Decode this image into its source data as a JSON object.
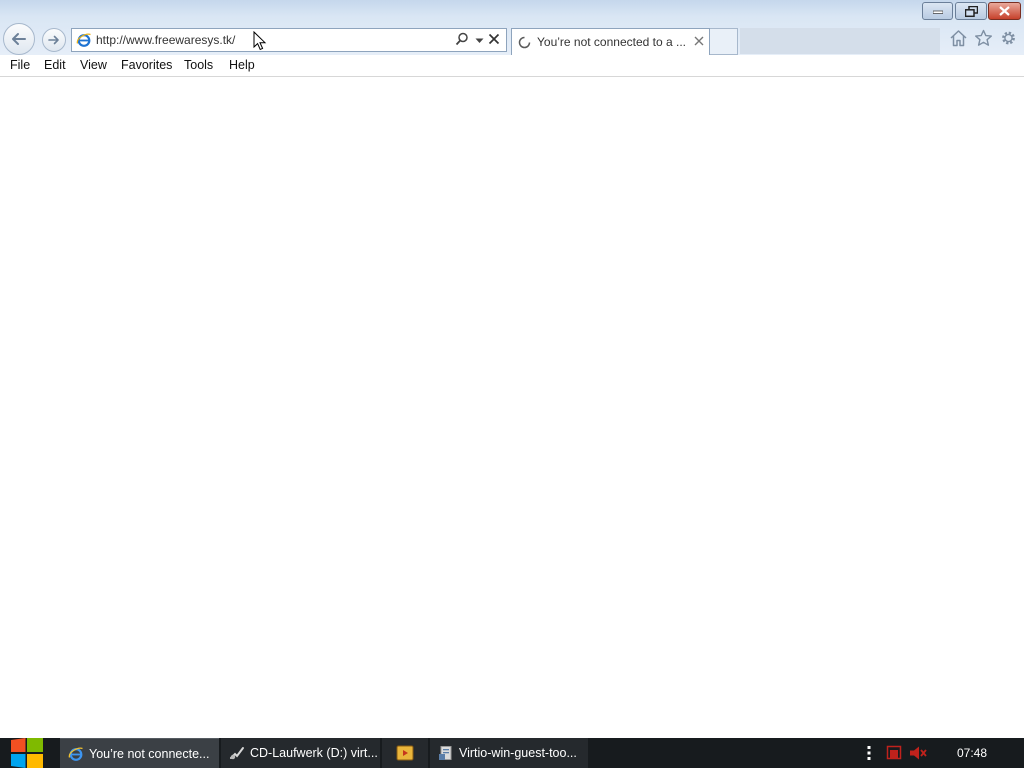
{
  "browser": {
    "address": {
      "url": "http://www.freewaresys.tk/"
    },
    "tab": {
      "title": "You’re not connected to a ..."
    }
  },
  "menu": {
    "items": [
      {
        "label": "File"
      },
      {
        "label": "Edit"
      },
      {
        "label": "View"
      },
      {
        "label": "Favorites"
      },
      {
        "label": "Tools"
      },
      {
        "label": "Help"
      }
    ]
  },
  "taskbar": {
    "items": [
      {
        "label": "You’re not connecte...",
        "icon": "internet-explorer-icon",
        "active": true
      },
      {
        "label": "CD-Laufwerk (D:) virt...",
        "icon": "cd-drive-icon",
        "active": false
      },
      {
        "label": "",
        "icon": "media-player-icon",
        "active": false
      },
      {
        "label": "Virtio-win-guest-too...",
        "icon": "installer-icon",
        "active": false
      }
    ],
    "tray": {
      "clock": "07:48"
    }
  },
  "colors": {
    "titlebar": "#d9e6f4",
    "taskbar": "#171b1e",
    "close_button": "#c7412b",
    "ie_blue": "#1e73d2"
  }
}
